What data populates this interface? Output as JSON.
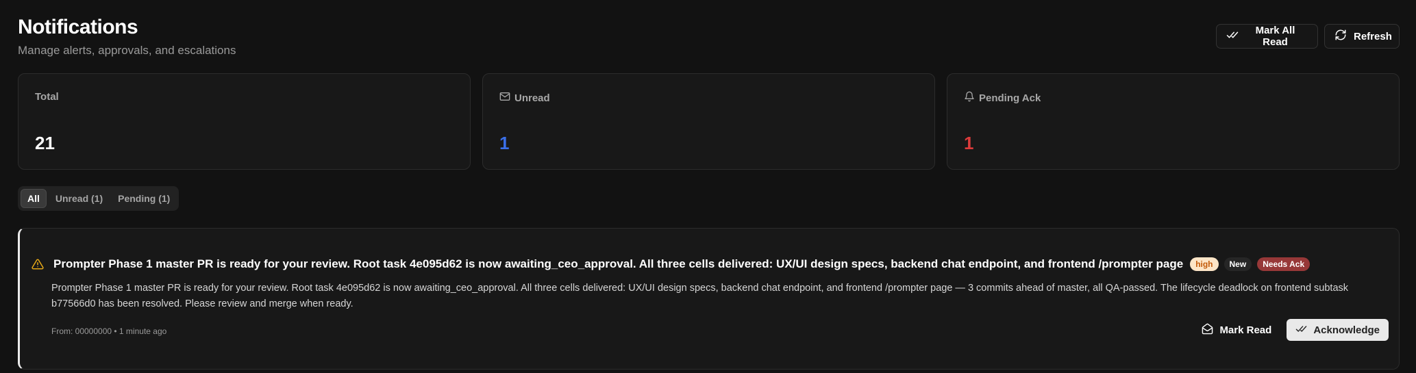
{
  "header": {
    "title": "Notifications",
    "subtitle": "Manage alerts, approvals, and escalations"
  },
  "actions": {
    "mark_all_read": "Mark All Read",
    "refresh": "Refresh"
  },
  "stats": {
    "total": {
      "label": "Total",
      "value": "21"
    },
    "unread": {
      "label": "Unread",
      "value": "1",
      "icon": "mail-icon",
      "color": "#3a6fe8"
    },
    "pending": {
      "label": "Pending Ack",
      "value": "1",
      "icon": "bell-icon",
      "color": "#dc3b3b"
    }
  },
  "tabs": [
    {
      "label": "All",
      "active": true
    },
    {
      "label": "Unread (1)"
    },
    {
      "label": "Pending (1)"
    }
  ],
  "notification": {
    "icon": "warning-triangle-icon",
    "title": "Prompter Phase 1 master PR is ready for your review. Root task 4e095d62 is now awaiting_ceo_approval. All three cells delivered: UX/UI design specs, backend chat endpoint, and frontend /prompter page",
    "badges": {
      "priority": "high",
      "status": "New",
      "ack": "Needs Ack"
    },
    "body": "Prompter Phase 1 master PR is ready for your review. Root task 4e095d62 is now awaiting_ceo_approval. All three cells delivered: UX/UI design specs, backend chat endpoint, and frontend /prompter page — 3 commits ahead of master, all QA-passed. The lifecycle deadlock on frontend subtask b77566d0 has been resolved. Please review and merge when ready.",
    "meta": "From: 00000000 • 1 minute ago",
    "mark_read": "Mark Read",
    "acknowledge": "Acknowledge"
  }
}
